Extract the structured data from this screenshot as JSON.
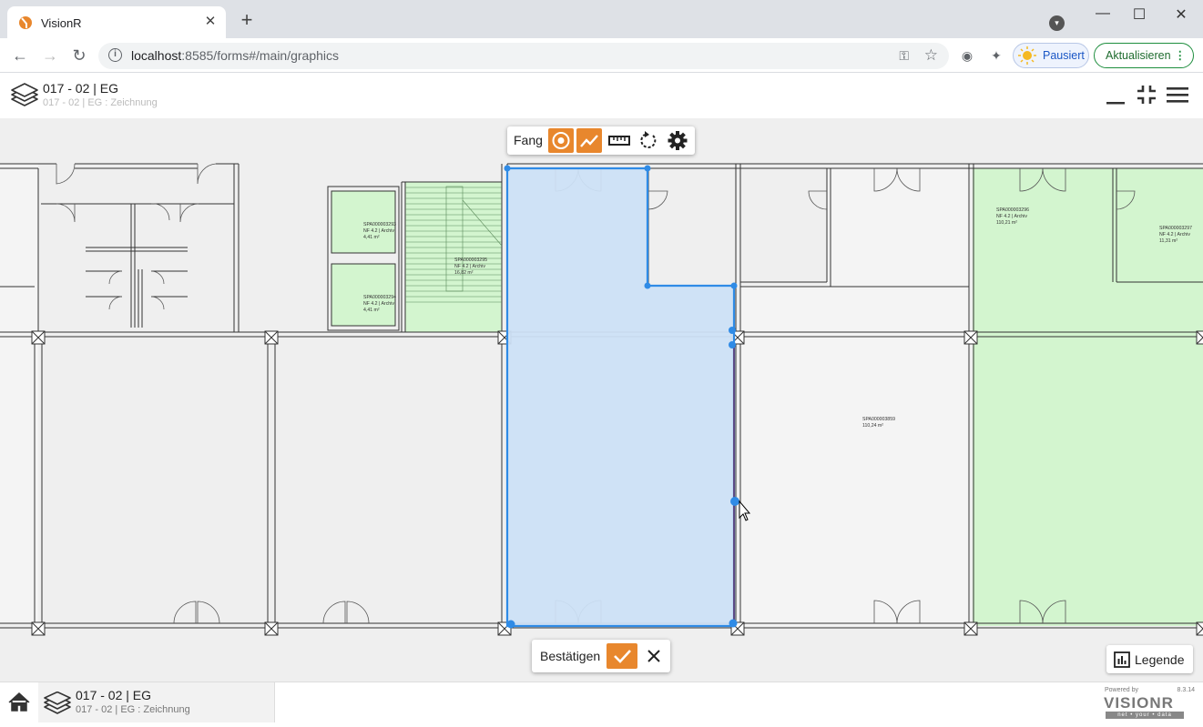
{
  "browser": {
    "tab_title": "VisionR",
    "tab_close": "✕",
    "new_tab": "+",
    "url_host": "localhost",
    "url_rest": ":8585/forms#/main/graphics",
    "paused_label": "Pausiert",
    "update_label": "Aktualisieren",
    "win_minimize": "—",
    "win_maximize": "☐",
    "win_close": "✕"
  },
  "header": {
    "title": "017 - 02 | EG",
    "subtitle": "017 - 02 | EG : Zeichnung"
  },
  "toolbar": {
    "snap_label": "Fang",
    "snap_point_active": true,
    "snap_line_active": true
  },
  "rooms": [
    {
      "id": "SPA000003293",
      "line2": "NF 4.2 | Archiv",
      "area": "4,41 m²"
    },
    {
      "id": "SPA000003294",
      "line2": "NF 4.2 | Archiv",
      "area": "4,41 m²"
    },
    {
      "id": "SPA000003295",
      "line2": "NF 4.2 | Archiv",
      "area": "16,82 m²"
    },
    {
      "id": "SPA000003296",
      "line2": "NF 4.2 | Archiv",
      "area": "110,21 m²"
    },
    {
      "id": "SPA000003297",
      "line2": "NF 4.2 | Archiv",
      "area": "11,31 m²"
    },
    {
      "id": "SPA000003859",
      "line2": "110,24 m²",
      "area": ""
    }
  ],
  "confirm": {
    "label": "Bestätigen"
  },
  "legend": {
    "label": "Legende"
  },
  "footer": {
    "title": "017 - 02 | EG",
    "subtitle": "017 - 02 | EG : Zeichnung",
    "powered_by": "Powered by",
    "version": "8.3.14",
    "brand": "VISIONR",
    "tagline": "net • your • data"
  },
  "colors": {
    "accent": "#e8872d",
    "selection_fill": "#cce0f5",
    "selection_stroke": "#2f8be6",
    "room_green": "#d3f5cf"
  }
}
